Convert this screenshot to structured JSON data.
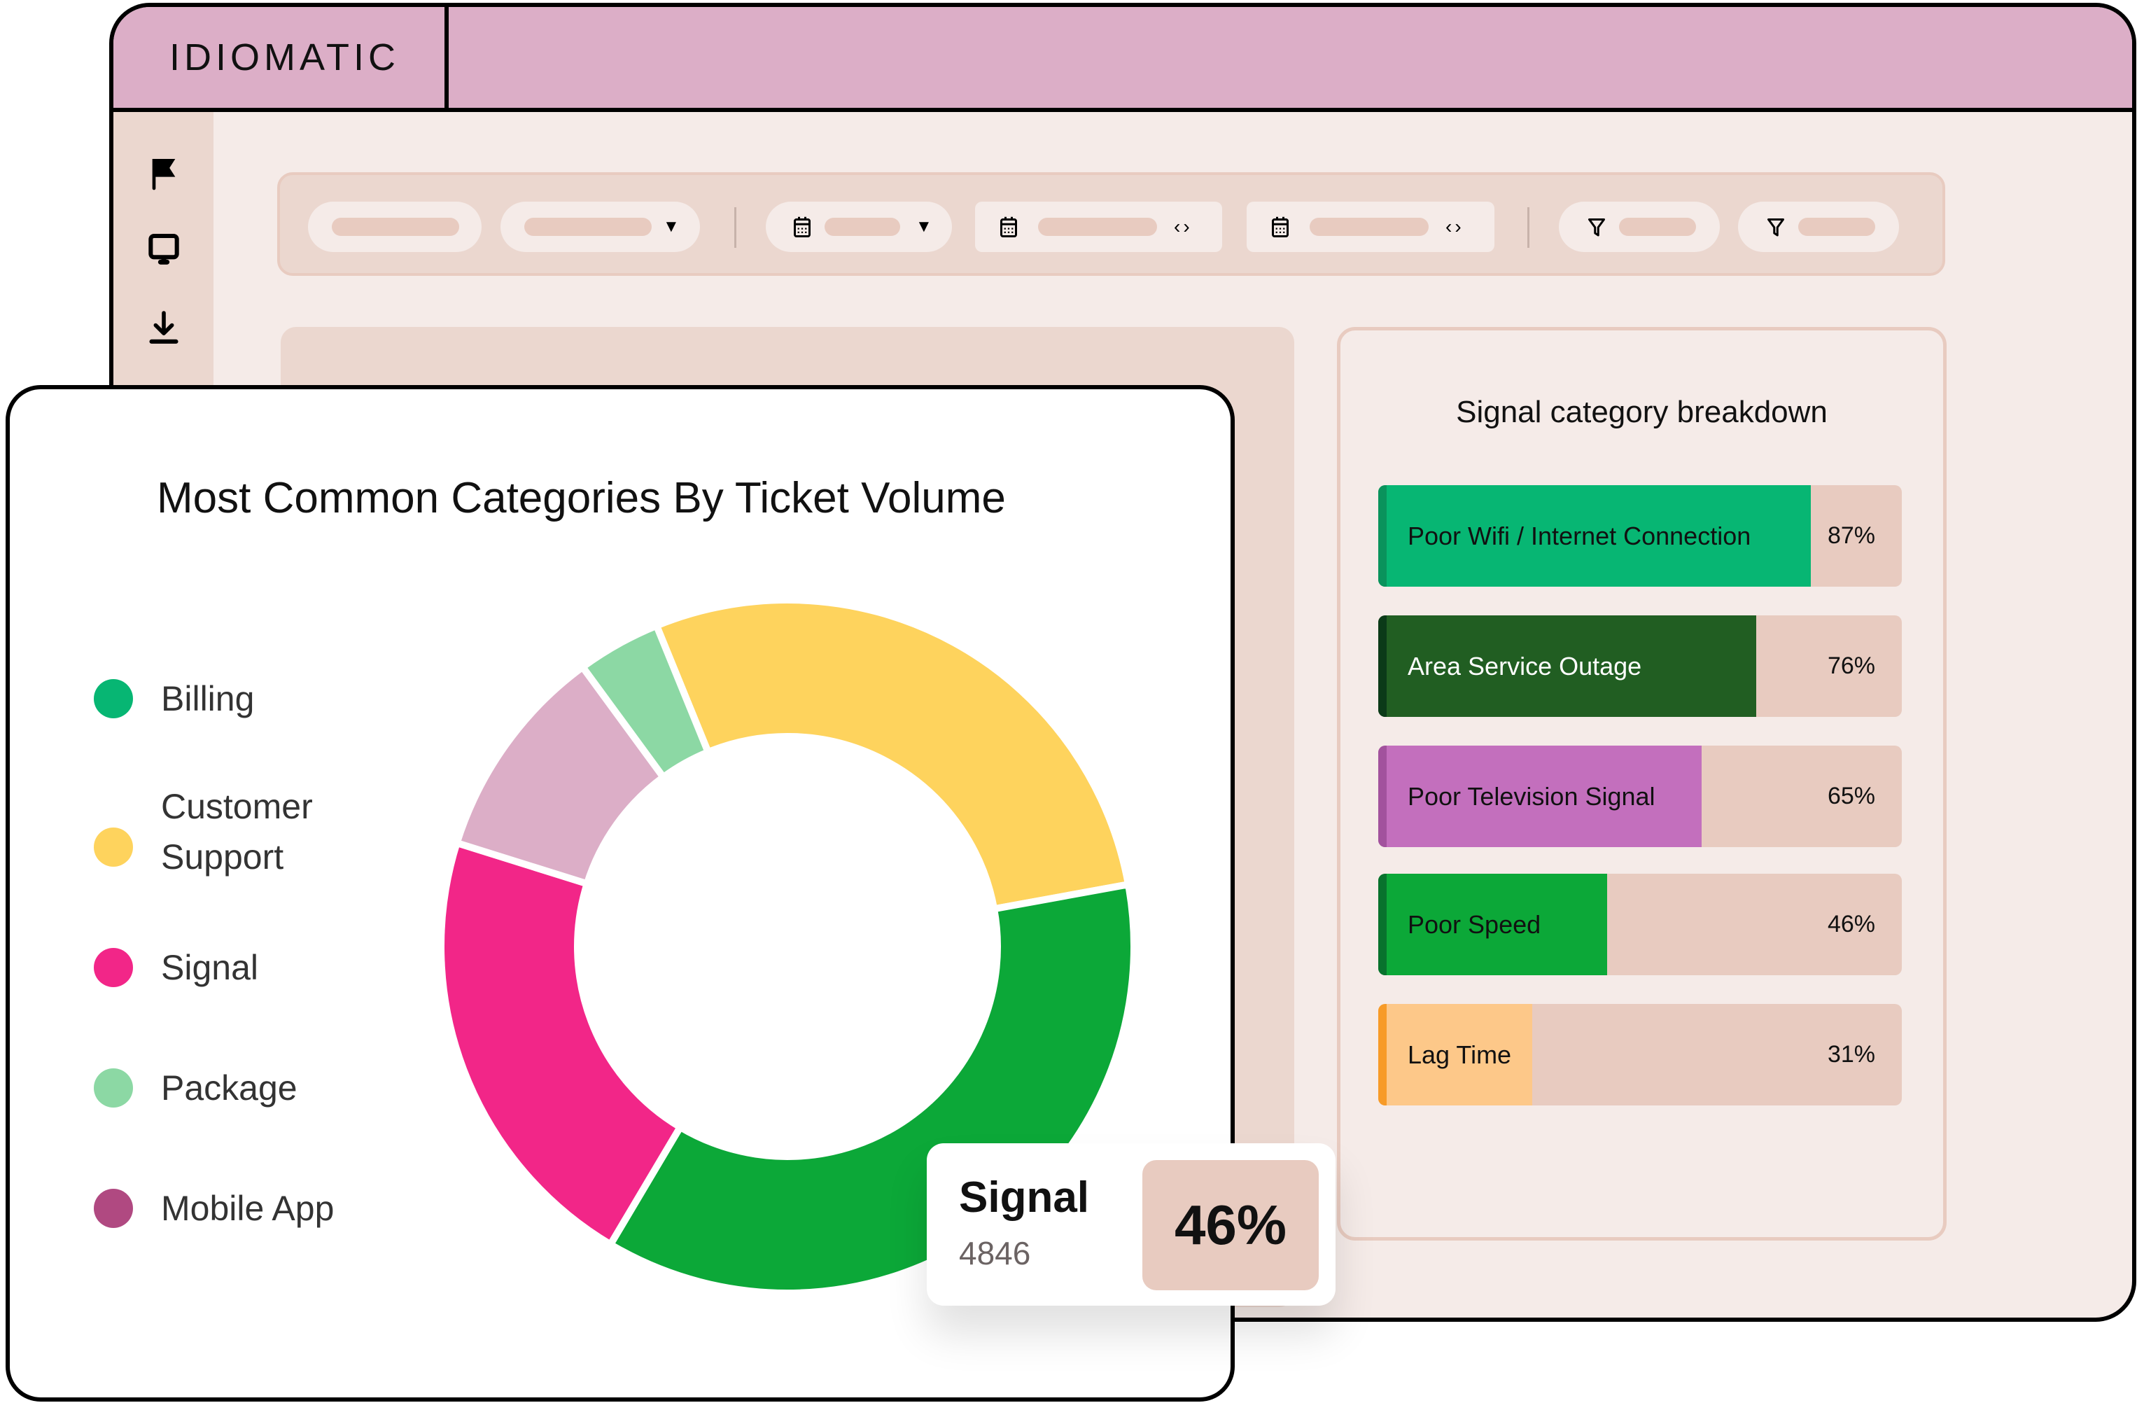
{
  "app": {
    "logo": "IDIOMATIC"
  },
  "sidebar": {
    "items": [
      {
        "icon": "flag-icon"
      },
      {
        "icon": "monitor-icon"
      },
      {
        "icon": "download-icon"
      }
    ]
  },
  "filterbar": {
    "caret": "▼",
    "arrows": "‹›"
  },
  "breakdown": {
    "title": "Signal category breakdown",
    "track_color": "#e8cbc0",
    "rows": [
      {
        "label": "Poor Wifi / Internet Connection",
        "value": 87,
        "value_label": "87%",
        "color": "#07b673",
        "accent": "#0a935c",
        "text_color": "#111111"
      },
      {
        "label": "Area Service Outage",
        "value": 76,
        "value_label": "76%",
        "color": "#215e22",
        "accent": "#0b3a18",
        "text_color": "#ffffff"
      },
      {
        "label": "Poor Television Signal",
        "value": 65,
        "value_label": "65%",
        "color": "#c36fbd",
        "accent": "#a2529d",
        "text_color": "#111111"
      },
      {
        "label": "Poor Speed",
        "value": 46,
        "value_label": "46%",
        "color": "#0ca838",
        "accent": "#08722d",
        "text_color": "#111111"
      },
      {
        "label": "Lag Time",
        "value": 31,
        "value_label": "31%",
        "color": "#fdc889",
        "accent": "#f79b28",
        "text_color": "#111111"
      }
    ]
  },
  "chart_data": {
    "type": "pie",
    "title": "Most Common Categories By Ticket Volume",
    "legend": [
      {
        "name": "Billing",
        "color": "#07b673"
      },
      {
        "name": "Customer Support",
        "color": "#fed35d"
      },
      {
        "name": "Signal",
        "color": "#f22688"
      },
      {
        "name": "Package",
        "color": "#8cd8a4"
      },
      {
        "name": "Mobile App",
        "color": "#b04981"
      }
    ],
    "slices": [
      {
        "name": "Customer Support",
        "value": 28.3,
        "color": "#fed35d"
      },
      {
        "name": "Green segment",
        "value": 36.4,
        "color": "#0ca838"
      },
      {
        "name": "Signal",
        "value": 21.3,
        "color": "#f22688"
      },
      {
        "name": "Mauve segment",
        "value": 10.1,
        "color": "#dcaec7"
      },
      {
        "name": "Package",
        "value": 3.9,
        "color": "#8cd8a4"
      }
    ],
    "start_angle_deg": 337.8,
    "legend_position": "left",
    "tooltip": {
      "name": "Signal",
      "count": "4846",
      "percent": "46%"
    }
  }
}
